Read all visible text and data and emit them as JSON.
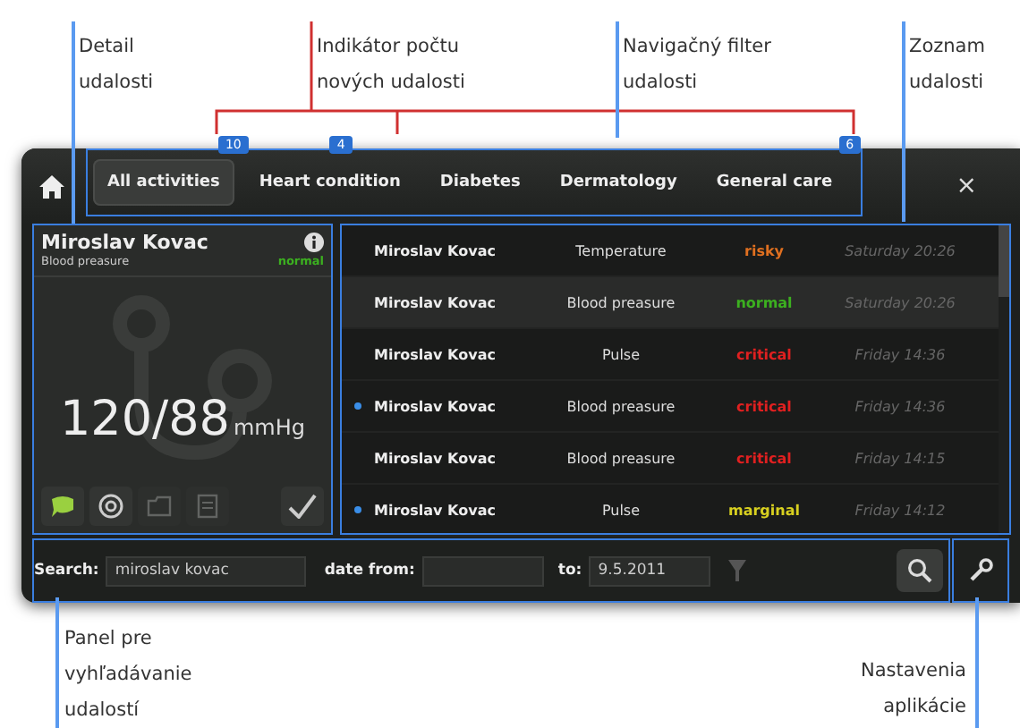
{
  "callouts": [
    {
      "lines": [
        "Detail",
        "udalosti"
      ],
      "color": "#5a9af0"
    },
    {
      "lines": [
        "Indikátor počtu",
        "nových udalosti"
      ],
      "color": "#d03030"
    },
    {
      "lines": [
        "Navigačný filter",
        "udalosti"
      ],
      "color": "#5a9af0"
    },
    {
      "lines": [
        "Zoznam",
        "udalosti"
      ],
      "color": "#5a9af0"
    },
    {
      "lines": [
        "Panel pre",
        "vyhľadávanie",
        "udalostí"
      ],
      "color": "#5a9af0"
    },
    {
      "lines": [
        "Nastavenia",
        "aplikácie"
      ],
      "color": "#5a9af0"
    }
  ],
  "tabs": [
    {
      "label": "All activities",
      "selected": true,
      "badge": "10"
    },
    {
      "label": "Heart condition",
      "selected": false,
      "badge": "4"
    },
    {
      "label": "Diabetes",
      "selected": false
    },
    {
      "label": "Dermatology",
      "selected": false
    },
    {
      "label": "General care",
      "selected": false,
      "badge": "6"
    }
  ],
  "close": "×",
  "detail": {
    "name": "Miroslav Kovac",
    "measure": "Blood preasure",
    "status": "normal",
    "color": "#3cb020",
    "value": "120/88",
    "unit": "mmHg",
    "tools": [
      {
        "kind": "message",
        "disabled": false
      },
      {
        "kind": "target",
        "disabled": false
      },
      {
        "kind": "folder",
        "disabled": true
      },
      {
        "kind": "list",
        "disabled": true
      },
      {
        "kind": "check",
        "disabled": false
      }
    ]
  },
  "events": [
    {
      "new": false,
      "selected": false,
      "name": "Miroslav Kovac",
      "measure": "Temperature",
      "status": "risky",
      "color": "#e07020",
      "time": "Saturday 20:26"
    },
    {
      "new": false,
      "selected": true,
      "name": "Miroslav Kovac",
      "measure": "Blood preasure",
      "status": "normal",
      "color": "#3cb020",
      "time": "Saturday 20:26"
    },
    {
      "new": false,
      "selected": false,
      "name": "Miroslav Kovac",
      "measure": "Pulse",
      "status": "critical",
      "color": "#e02020",
      "time": "Friday 14:36"
    },
    {
      "new": true,
      "selected": false,
      "name": "Miroslav Kovac",
      "measure": "Blood preasure",
      "status": "critical",
      "color": "#e02020",
      "time": "Friday 14:36"
    },
    {
      "new": false,
      "selected": false,
      "name": "Miroslav Kovac",
      "measure": "Blood preasure",
      "status": "critical",
      "color": "#e02020",
      "time": "Friday 14:15"
    },
    {
      "new": true,
      "selected": false,
      "name": "Miroslav Kovac",
      "measure": "Pulse",
      "status": "marginal",
      "color": "#d8d020",
      "time": "Friday 14:12"
    }
  ],
  "search": {
    "label": "Search:",
    "value": "miroslav kovac",
    "from_label": "date from:",
    "to_label": "to:",
    "to_value": "9.5.2011"
  }
}
